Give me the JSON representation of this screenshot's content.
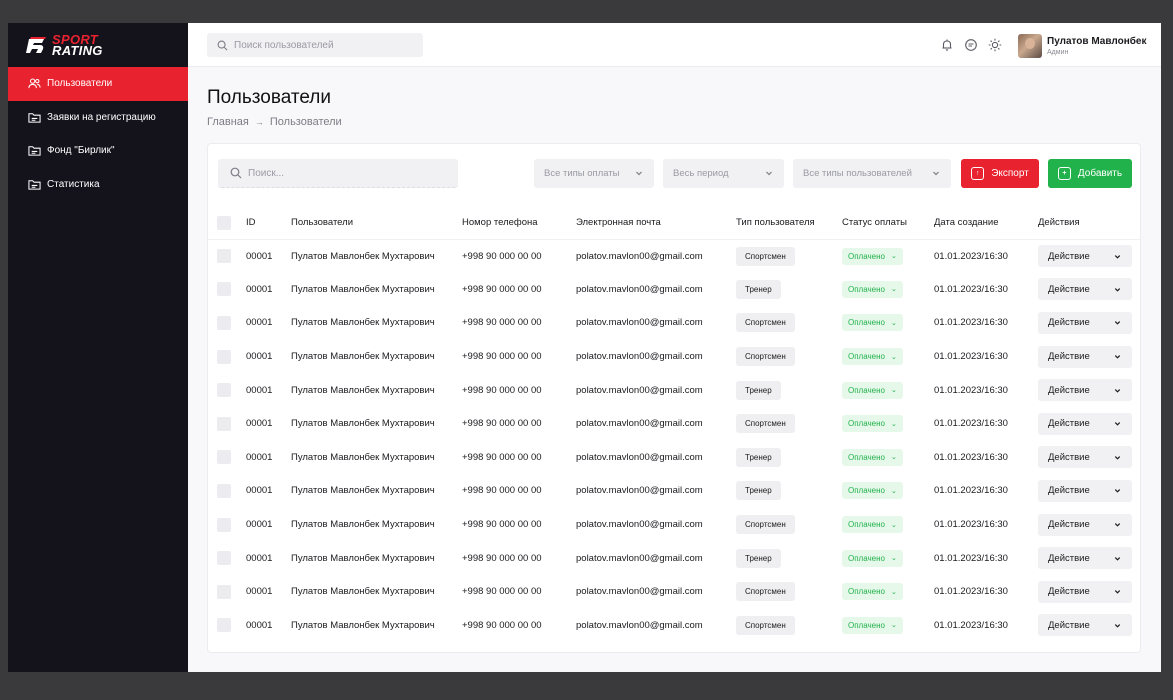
{
  "brand": {
    "line1": "Sport",
    "line2": "Rating",
    "accent": "#e8222f",
    "sidebar_bg": "#14131c",
    "success": "#22b24c"
  },
  "sidebar": {
    "items": [
      {
        "label": "Пользователи",
        "icon": "users-icon",
        "active": true
      },
      {
        "label": "Заявки на регистрацию",
        "icon": "folder-icon",
        "active": false
      },
      {
        "label": "Фонд \"Бирлик\"",
        "icon": "folder-icon",
        "active": false
      },
      {
        "label": "Статистика",
        "icon": "folder-icon",
        "active": false
      }
    ]
  },
  "topbar": {
    "search_placeholder": "Поиск пользователей",
    "icons": [
      "bell-icon",
      "chat-icon",
      "sun-icon"
    ],
    "user": {
      "name": "Пулатов Мавлонбек",
      "role": "Админ"
    }
  },
  "page": {
    "title": "Пользователи",
    "breadcrumb": [
      "Главная",
      "Пользователи"
    ]
  },
  "filters": {
    "search_placeholder": "Поиск...",
    "payment_type": "Все типы оплаты",
    "period": "Весь период",
    "user_type": "Все типы пользователей",
    "export_label": "Экспорт",
    "add_label": "Добавить"
  },
  "table": {
    "headers": [
      "ID",
      "Пользователи",
      "Номор телефона",
      "Электронная почта",
      "Тип пользователя",
      "Статус оплаты",
      "Дата создание",
      "Действия"
    ],
    "rows": [
      {
        "id": "00001",
        "name": "Пулатов Мавлонбек Мухтарович",
        "phone": "+998 90 000 00 00",
        "email": "polatov.mavlon00@gmail.com",
        "type": "Спортсмен",
        "status": "Оплачено",
        "date": "01.01.2023/16:30",
        "action": "Действие"
      },
      {
        "id": "00001",
        "name": "Пулатов Мавлонбек Мухтарович",
        "phone": "+998 90 000 00 00",
        "email": "polatov.mavlon00@gmail.com",
        "type": "Тренер",
        "status": "Оплачено",
        "date": "01.01.2023/16:30",
        "action": "Действие"
      },
      {
        "id": "00001",
        "name": "Пулатов Мавлонбек Мухтарович",
        "phone": "+998 90 000 00 00",
        "email": "polatov.mavlon00@gmail.com",
        "type": "Спортсмен",
        "status": "Оплачено",
        "date": "01.01.2023/16:30",
        "action": "Действие"
      },
      {
        "id": "00001",
        "name": "Пулатов Мавлонбек Мухтарович",
        "phone": "+998 90 000 00 00",
        "email": "polatov.mavlon00@gmail.com",
        "type": "Спортсмен",
        "status": "Оплачено",
        "date": "01.01.2023/16:30",
        "action": "Действие"
      },
      {
        "id": "00001",
        "name": "Пулатов Мавлонбек Мухтарович",
        "phone": "+998 90 000 00 00",
        "email": "polatov.mavlon00@gmail.com",
        "type": "Тренер",
        "status": "Оплачено",
        "date": "01.01.2023/16:30",
        "action": "Действие"
      },
      {
        "id": "00001",
        "name": "Пулатов Мавлонбек Мухтарович",
        "phone": "+998 90 000 00 00",
        "email": "polatov.mavlon00@gmail.com",
        "type": "Спортсмен",
        "status": "Оплачено",
        "date": "01.01.2023/16:30",
        "action": "Действие"
      },
      {
        "id": "00001",
        "name": "Пулатов Мавлонбек Мухтарович",
        "phone": "+998 90 000 00 00",
        "email": "polatov.mavlon00@gmail.com",
        "type": "Тренер",
        "status": "Оплачено",
        "date": "01.01.2023/16:30",
        "action": "Действие"
      },
      {
        "id": "00001",
        "name": "Пулатов Мавлонбек Мухтарович",
        "phone": "+998 90 000 00 00",
        "email": "polatov.mavlon00@gmail.com",
        "type": "Тренер",
        "status": "Оплачено",
        "date": "01.01.2023/16:30",
        "action": "Действие"
      },
      {
        "id": "00001",
        "name": "Пулатов Мавлонбек Мухтарович",
        "phone": "+998 90 000 00 00",
        "email": "polatov.mavlon00@gmail.com",
        "type": "Спортсмен",
        "status": "Оплачено",
        "date": "01.01.2023/16:30",
        "action": "Действие"
      },
      {
        "id": "00001",
        "name": "Пулатов Мавлонбек Мухтарович",
        "phone": "+998 90 000 00 00",
        "email": "polatov.mavlon00@gmail.com",
        "type": "Тренер",
        "status": "Оплачено",
        "date": "01.01.2023/16:30",
        "action": "Действие"
      },
      {
        "id": "00001",
        "name": "Пулатов Мавлонбек Мухтарович",
        "phone": "+998 90 000 00 00",
        "email": "polatov.mavlon00@gmail.com",
        "type": "Спортсмен",
        "status": "Оплачено",
        "date": "01.01.2023/16:30",
        "action": "Действие"
      },
      {
        "id": "00001",
        "name": "Пулатов Мавлонбек Мухтарович",
        "phone": "+998 90 000 00 00",
        "email": "polatov.mavlon00@gmail.com",
        "type": "Спортсмен",
        "status": "Оплачено",
        "date": "01.01.2023/16:30",
        "action": "Действие"
      }
    ]
  }
}
